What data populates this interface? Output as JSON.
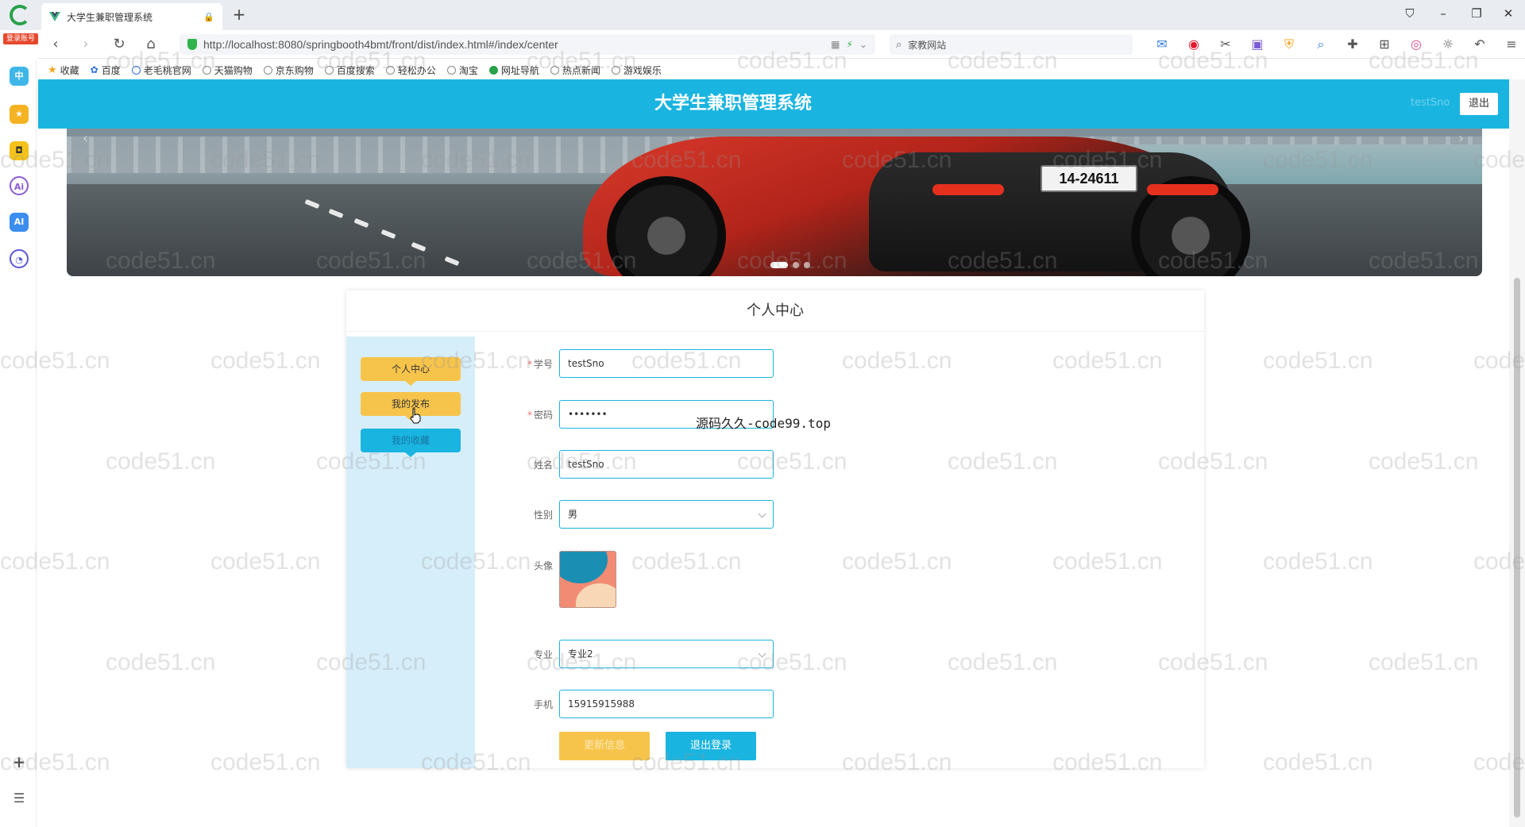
{
  "browser": {
    "tab_title": "大学生兼职管理系统",
    "badge": "登录账号",
    "url": "http://localhost:8080/springbooth4bmt/front/dist/index.html#/index/center",
    "search_placeholder": "家教网站",
    "bookmarks": [
      "收藏",
      "百度",
      "老毛桃官网",
      "天猫购物",
      "京东购物",
      "百度搜索",
      "轻松办公",
      "淘宝",
      "网址导航",
      "热点新闻",
      "游戏娱乐"
    ]
  },
  "header": {
    "title": "大学生兼职管理系统",
    "username": "testSno",
    "logout": "退出"
  },
  "carousel": {
    "plate": "14-24611",
    "active_index": 0,
    "count": 3
  },
  "center": {
    "title": "个人中心",
    "menu": [
      "个人中心",
      "我的发布",
      "我的收藏"
    ],
    "fields": {
      "sno_label": "学号",
      "sno_value": "testSno",
      "password_label": "密码",
      "password_value": "•••••••",
      "name_label": "姓名",
      "name_value": "testSno",
      "gender_label": "性别",
      "gender_value": "男",
      "avatar_label": "头像",
      "major_label": "专业",
      "major_value": "专业2",
      "phone_label": "手机",
      "phone_value": "15915915988"
    },
    "update_button": "更新信息",
    "logout_button": "退出登录"
  },
  "overlay": "源码久久-code99.top",
  "watermark": "code51.cn",
  "colors": {
    "primary": "#1ab4e0",
    "accent": "#f7c44b",
    "menu_bg": "#d6eefa"
  }
}
